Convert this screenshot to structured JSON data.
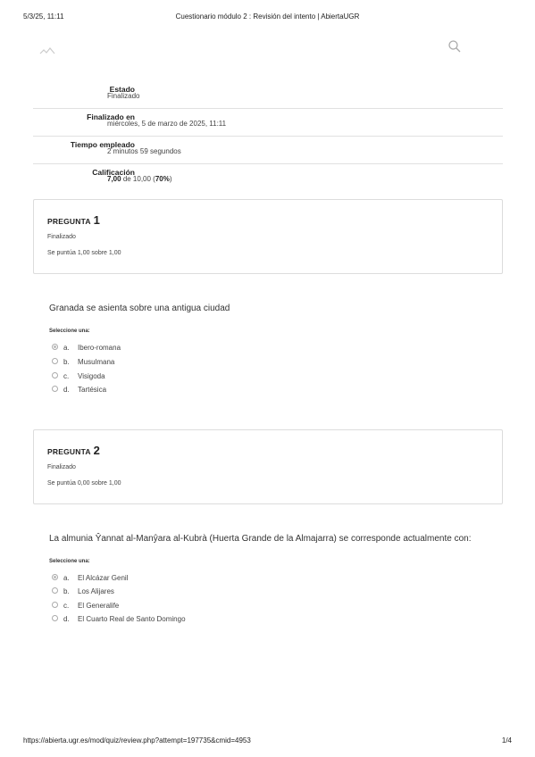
{
  "print_header": {
    "date": "5/3/25, 11:11",
    "title": "Cuestionario módulo 2 : Revisión del intento | AbiertaUGR"
  },
  "print_footer": {
    "url": "https://abierta.ugr.es/mod/quiz/review.php?attempt=197735&cmid=4953",
    "page": "1/4"
  },
  "header": {
    "logo_icon": "ugr-logo-icon",
    "search_icon": "search-icon"
  },
  "summary": [
    {
      "label": "Estado",
      "value": "Finalizado"
    },
    {
      "label": "Finalizado en",
      "value": "miércoles, 5 de marzo de 2025, 11:11"
    },
    {
      "label": "Tiempo empleado",
      "value": "2 minutos 59 segundos"
    },
    {
      "label": "Calificación",
      "grade": "7,00",
      "of_text": "de 10,00",
      "percent": "70%"
    }
  ],
  "questions": [
    {
      "heading": "PREGUNTA",
      "number": "1",
      "state": "Finalizado",
      "grade": "Se puntúa 1,00 sobre 1,00",
      "text": "Granada se asienta sobre una antigua ciudad",
      "select_hint": "Seleccione una:",
      "answers": [
        {
          "letter": "a.",
          "text": "Ibero-romana",
          "checked": true
        },
        {
          "letter": "b.",
          "text": "Musulmana",
          "checked": false
        },
        {
          "letter": "c.",
          "text": "Visigoda",
          "checked": false
        },
        {
          "letter": "d.",
          "text": "Tartésica",
          "checked": false
        }
      ]
    },
    {
      "heading": "PREGUNTA",
      "number": "2",
      "state": "Finalizado",
      "grade": "Se puntúa 0,00 sobre 1,00",
      "text": "La almunia Ŷannat al-Manŷara al-Kubrà (Huerta Grande de la Almajarra) se corresponde actualmente con:",
      "select_hint": "Seleccione una:",
      "answers": [
        {
          "letter": "a.",
          "text": "El Alcázar Genil",
          "checked": true
        },
        {
          "letter": "b.",
          "text": "Los Alijares",
          "checked": false
        },
        {
          "letter": "c.",
          "text": "El Generalife",
          "checked": false
        },
        {
          "letter": "d.",
          "text": "El Cuarto Real de Santo Domingo",
          "checked": false
        }
      ]
    }
  ]
}
